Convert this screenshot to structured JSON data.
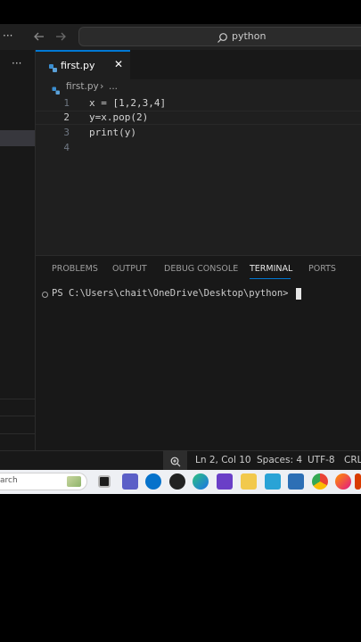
{
  "titlebar": {
    "search_text": "python",
    "more": "···"
  },
  "sidebar": {
    "more": "···"
  },
  "tab": {
    "label": "first.py",
    "close": "✕"
  },
  "breadcrumb": {
    "file": "first.py",
    "sep": "›",
    "more": "..."
  },
  "editor": {
    "lines": [
      {
        "num": "1",
        "code": "x = [1,2,3,4]"
      },
      {
        "num": "2",
        "code": "y=x.pop(2)"
      },
      {
        "num": "3",
        "code": "print(y)"
      },
      {
        "num": "4",
        "code": ""
      }
    ],
    "active_line": 2
  },
  "panel": {
    "tabs": [
      "PROBLEMS",
      "OUTPUT",
      "DEBUG CONSOLE",
      "TERMINAL",
      "PORTS"
    ],
    "active_tab": "TERMINAL",
    "terminal_prompt": "PS C:\\Users\\chait\\OneDrive\\Desktop\\python>"
  },
  "statusbar": {
    "position": "Ln 2, Col 10",
    "spaces": "Spaces: 4",
    "encoding": "UTF-8",
    "eol": "CRL"
  },
  "taskbar": {
    "search_placeholder": "arch",
    "icons": [
      "file-explorer-icon",
      "teams-icon",
      "dell-icon",
      "game-icon",
      "edge-icon",
      "clapper-icon",
      "folder-icon",
      "notepad-icon",
      "store-icon",
      "chrome-icon",
      "firefox-icon",
      "office-icon"
    ]
  },
  "colors": {
    "accent": "#0078d4",
    "editor_bg": "#1f1f1f",
    "panel_bg": "#181818"
  }
}
